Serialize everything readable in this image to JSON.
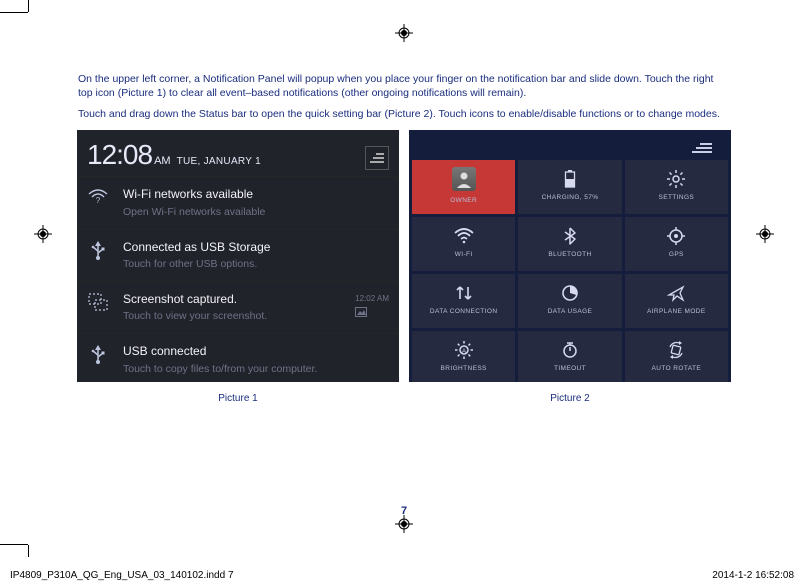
{
  "body": {
    "para1": "On the upper left corner, a Notification Panel will popup when you place your finger on the notification bar and slide down. Touch the right top icon (Picture 1) to clear all event–based notifications (other ongoing notifications will remain).",
    "para2": "Touch and drag down the Status bar to open the quick setting bar (Picture 2). Touch icons to enable/disable functions or to change modes."
  },
  "picture1": {
    "clock_big": "12:08",
    "clock_ampm": "AM",
    "clock_date": "TUE, JANUARY 1",
    "clear_label": "≡",
    "rows": [
      {
        "title": "Wi-Fi networks available",
        "sub": "Open Wi-Fi networks available",
        "time": ""
      },
      {
        "title": "Connected as USB Storage",
        "sub": "Touch for other USB options.",
        "time": ""
      },
      {
        "title": "Screenshot captured.",
        "sub": "Touch to view your screenshot.",
        "time": "12:02 AM"
      },
      {
        "title": "USB connected",
        "sub": "Touch to copy files to/from your computer.",
        "time": ""
      }
    ],
    "caption": "Picture 1"
  },
  "picture2": {
    "tiles": [
      {
        "kind": "owner",
        "label": "OWNER"
      },
      {
        "kind": "battery",
        "label": "CHARGING, 57%"
      },
      {
        "kind": "settings",
        "label": "SETTINGS"
      },
      {
        "kind": "wifi",
        "label": "WI-FI"
      },
      {
        "kind": "bluetooth",
        "label": "BLUETOOTH"
      },
      {
        "kind": "gps",
        "label": "GPS"
      },
      {
        "kind": "data",
        "label": "DATA CONNECTION"
      },
      {
        "kind": "usage",
        "label": "DATA USAGE"
      },
      {
        "kind": "airplane",
        "label": "AIRPLANE MODE"
      },
      {
        "kind": "brightness",
        "label": "BRIGHTNESS"
      },
      {
        "kind": "timeout",
        "label": "TIMEOUT"
      },
      {
        "kind": "rotate",
        "label": "AUTO ROTATE"
      }
    ],
    "caption": "Picture 2"
  },
  "page_number": "7",
  "footer": {
    "left": "IP4809_P310A_QG_Eng_USA_03_140102.indd   7",
    "right": "2014-1-2   16:52:08"
  }
}
